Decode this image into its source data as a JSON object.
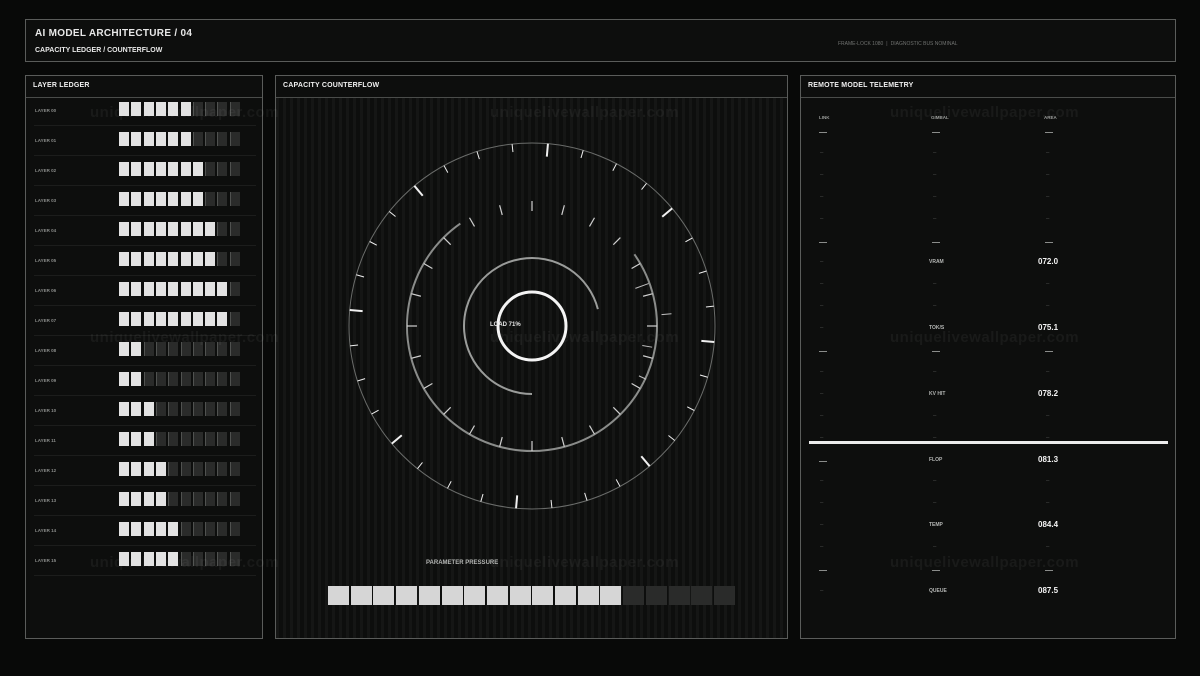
{
  "header": {
    "title": "AI MODEL ARCHITECTURE / 04",
    "subtitle": "CAPACITY LEDGER / COUNTERFLOW",
    "status_left": "FRAME-LOCK 1080",
    "status_sep": "|",
    "status_right": "DIAGNOSTIC BUS NOMINAL"
  },
  "ledger": {
    "title": "LAYER LEDGER",
    "total_cells": 10,
    "layers": [
      {
        "label": "LAYER 00",
        "filled": 6
      },
      {
        "label": "LAYER 01",
        "filled": 6
      },
      {
        "label": "LAYER 02",
        "filled": 7
      },
      {
        "label": "LAYER 03",
        "filled": 7
      },
      {
        "label": "LAYER 04",
        "filled": 8
      },
      {
        "label": "LAYER 05",
        "filled": 8
      },
      {
        "label": "LAYER 06",
        "filled": 9
      },
      {
        "label": "LAYER 07",
        "filled": 9
      },
      {
        "label": "LAYER 08",
        "filled": 2
      },
      {
        "label": "LAYER 09",
        "filled": 2
      },
      {
        "label": "LAYER 10",
        "filled": 3
      },
      {
        "label": "LAYER 11",
        "filled": 3
      },
      {
        "label": "LAYER 12",
        "filled": 4
      },
      {
        "label": "LAYER 13",
        "filled": 4
      },
      {
        "label": "LAYER 14",
        "filled": 5
      },
      {
        "label": "LAYER 15",
        "filled": 5
      }
    ]
  },
  "counterflow": {
    "title": "CAPACITY COUNTERFLOW",
    "load_label": "LOAD 71%",
    "load_fraction": 0.71,
    "pressure_label": "PARAMETER PRESSURE",
    "pressure_total": 18,
    "pressure_filled": 13
  },
  "telemetry": {
    "title": "REMOTE MODEL TELEMETRY",
    "columns": [
      "LINK",
      "GIMBAL",
      "AREA"
    ],
    "metrics": [
      {
        "name": "VRAM",
        "value": "072.0"
      },
      {
        "name": "TOK/S",
        "value": "075.1"
      },
      {
        "name": "KV HIT",
        "value": "078.2"
      },
      {
        "name": "FLOP",
        "value": "081.3"
      },
      {
        "name": "TEMP",
        "value": "084.4"
      },
      {
        "name": "QUEUE",
        "value": "087.5"
      }
    ]
  },
  "watermark": "uniquelivewallpaper.com",
  "colors": {
    "background": "#080908",
    "panel": "#0d0e0d",
    "border": "#5a5c5a",
    "cell_on": "#e2e2e2",
    "cell_off": "#2a2b2a",
    "accent": "#ececec"
  }
}
